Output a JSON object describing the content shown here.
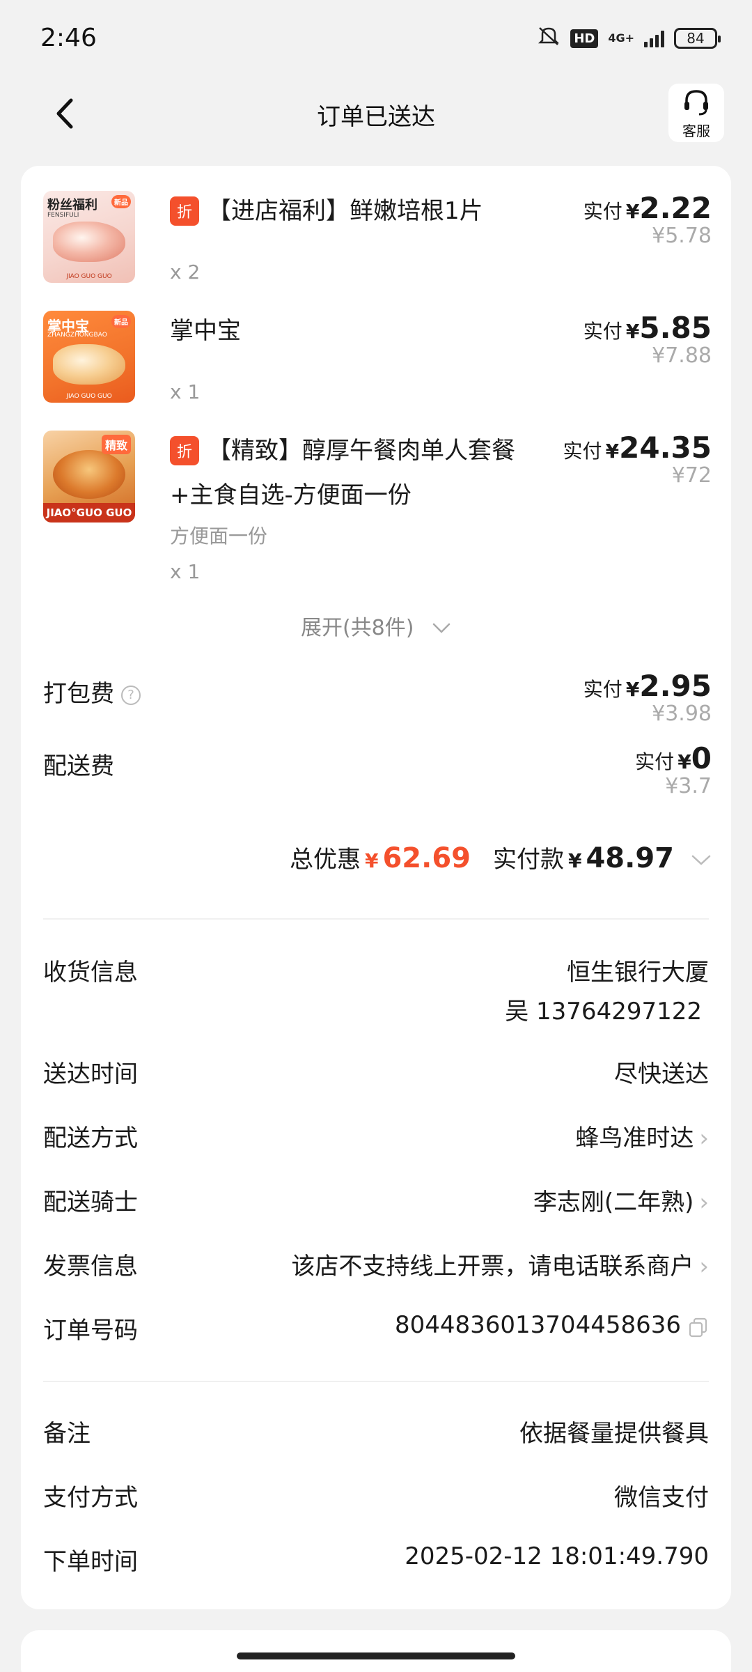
{
  "status_bar": {
    "time": "2:46",
    "network": "4G+",
    "hd": "HD",
    "battery": "84"
  },
  "header": {
    "title": "订单已送达",
    "service_label": "客服"
  },
  "items": [
    {
      "thumb_title": "粉丝福利",
      "thumb_sub": "FENSIFULI",
      "thumb_brand": "JIAO GUO GUO",
      "thumb_tag": "新品",
      "badge": "折",
      "name": "【进店福利】鲜嫩培根1片",
      "qty": "x 2",
      "paid_label": "实付",
      "currency": "¥",
      "paid": "2.22",
      "original": "¥5.78"
    },
    {
      "thumb_title": "掌中宝",
      "thumb_sub": "ZHANGZHONGBAO",
      "thumb_brand": "JIAO GUO GUO",
      "thumb_tag": "新品",
      "name": "掌中宝",
      "qty": "x 1",
      "paid_label": "实付",
      "currency": "¥",
      "paid": "5.85",
      "original": "¥7.88"
    },
    {
      "thumb_tag": "精致",
      "thumb_brand": "JIAO°GUO GUO",
      "badge": "折",
      "name_line1": "【精致】醇厚午餐肉单人套餐",
      "name_line2": "+主食自选-方便面一份",
      "spec": "方便面一份",
      "qty": "x 1",
      "paid_label": "实付",
      "currency": "¥",
      "paid": "24.35",
      "original": "¥72"
    }
  ],
  "expand_label": "展开(共8件)",
  "fees": [
    {
      "label": "打包费",
      "paid_label": "实付",
      "currency": "¥",
      "paid": "2.95",
      "original": "¥3.98"
    },
    {
      "label": "配送费",
      "paid_label": "实付",
      "currency": "¥",
      "paid": "0",
      "original": "¥3.7"
    }
  ],
  "totals": {
    "discount_label": "总优惠",
    "currency": "¥",
    "discount": "62.69",
    "paid_label": "实付款",
    "paid": "48.97"
  },
  "info": {
    "address_label": "收货信息",
    "address": "恒生银行大厦",
    "contact": "吴 13764297122",
    "delivery_time_label": "送达时间",
    "delivery_time": "尽快送达",
    "delivery_method_label": "配送方式",
    "delivery_method": "蜂鸟准时达",
    "rider_label": "配送骑士",
    "rider": "李志刚(二年熟)",
    "invoice_label": "发票信息",
    "invoice": "该店不支持线上开票，请电话联系商户",
    "order_no_label": "订单号码",
    "order_no": "8044836013704458636",
    "remark_label": "备注",
    "remark": "依据餐量提供餐具",
    "payment_label": "支付方式",
    "payment": "微信支付",
    "order_time_label": "下单时间",
    "order_time": "2025-02-12 18:01:49.790"
  }
}
